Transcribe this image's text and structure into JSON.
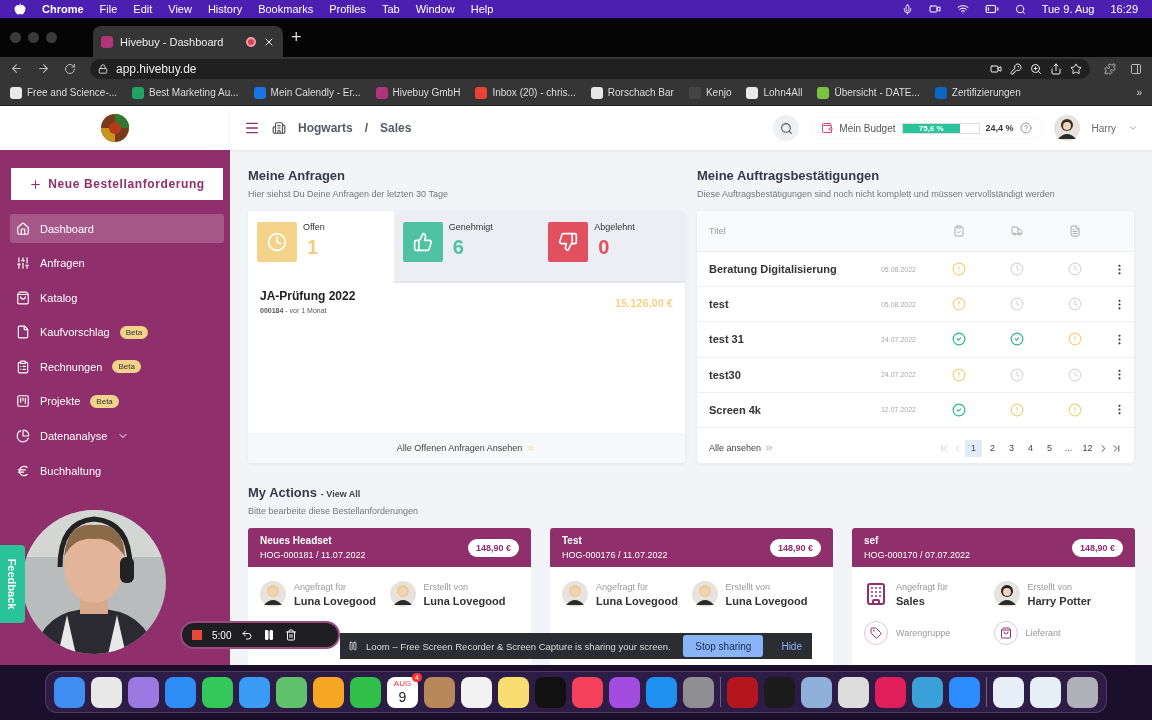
{
  "menubar": {
    "app": "Chrome",
    "menus": [
      "File",
      "Edit",
      "View",
      "History",
      "Bookmarks",
      "Profiles",
      "Tab",
      "Window",
      "Help"
    ],
    "date": "Tue 9. Aug",
    "time": "16:29"
  },
  "browser": {
    "tab": {
      "title": "Hivebuy - Dashboard",
      "selected": true
    },
    "new_tab": "+",
    "url": "app.hivebuy.de",
    "bookmarks": [
      {
        "label": "Free and Science-...",
        "color": "#e8e8e8"
      },
      {
        "label": "Best Marketing Au...",
        "color": "#1fa463"
      },
      {
        "label": "Mein Calendly - Er...",
        "color": "#1a73e8"
      },
      {
        "label": "Hivebuy GmbH",
        "color": "#b0347a"
      },
      {
        "label": "Inbox (20) - chris...",
        "color": "#ea4335"
      },
      {
        "label": "Rorschach Bar",
        "color": "#e8e8e8"
      },
      {
        "label": "Kenjo",
        "color": "#444444"
      },
      {
        "label": "Lohn4All",
        "color": "#e8e8e8"
      },
      {
        "label": "Übersicht - DATE...",
        "color": "#7cc242"
      },
      {
        "label": "Zertifizierungen",
        "color": "#0a66c2"
      }
    ],
    "more": "»"
  },
  "header": {
    "breadcrumb": [
      "Hogwarts",
      "Sales"
    ],
    "separator": "/",
    "budget": {
      "label": "Mein Budget",
      "level": 0.756,
      "used": "75,6 %",
      "rest": "24,4 %"
    },
    "user": "Harry"
  },
  "sidebar": {
    "new_button": "Neue Bestellanforderung",
    "items": [
      {
        "label": "Dashboard",
        "selected": true
      },
      {
        "label": "Anfragen",
        "selected": false
      },
      {
        "label": "Katalog",
        "selected": false
      },
      {
        "label": "Kaufvorschlag",
        "badge": "Beta",
        "selected": false
      },
      {
        "label": "Rechnungen",
        "badge": "Beta",
        "selected": false
      },
      {
        "label": "Projekte",
        "badge": "Beta",
        "selected": false
      },
      {
        "label": "Datenanalyse",
        "expandable": true,
        "selected": false
      },
      {
        "label": "Buchhaltung",
        "selected": false
      }
    ]
  },
  "requests": {
    "title": "Meine Anfragen",
    "subtitle": "Hier siehst Du Deine Anfragen der letzten 30 Tage",
    "stats": [
      {
        "kind": "open",
        "label": "Offen",
        "value": "1",
        "selected": true
      },
      {
        "kind": "approved",
        "label": "Genehmigt",
        "value": "6",
        "selected": false
      },
      {
        "kind": "rejected",
        "label": "Abgelehnt",
        "value": "0",
        "selected": false
      }
    ],
    "items": [
      {
        "title": "JA-Prüfung 2022",
        "meta": "**000184** - vor 1 Monat",
        "amount": "15.126,00 €"
      }
    ],
    "footer": "Alle Offenen Anfragen Ansehen"
  },
  "confirmations": {
    "title": "Meine Auftragsbestätigungen",
    "subtitle": "Diese Auftragsbestätigungen sind noch nicht komplett und müssen vervollständigt werden",
    "header": "Titel",
    "rows": [
      {
        "title": "Beratung Digitalisierung",
        "date": "05.08.2022",
        "statuses": [
          {
            "kind": "warning"
          },
          {
            "kind": "pending"
          },
          {
            "kind": "pending"
          }
        ]
      },
      {
        "title": "test",
        "date": "05.08.2022",
        "statuses": [
          {
            "kind": "warning"
          },
          {
            "kind": "pending"
          },
          {
            "kind": "pending"
          }
        ]
      },
      {
        "title": "test 31",
        "date": "24.07.2022",
        "statuses": [
          {
            "kind": "done"
          },
          {
            "kind": "done"
          },
          {
            "kind": "warning"
          }
        ]
      },
      {
        "title": "test30",
        "date": "24.07.2022",
        "statuses": [
          {
            "kind": "warning"
          },
          {
            "kind": "pending"
          },
          {
            "kind": "pending"
          }
        ]
      },
      {
        "title": "Screen 4k",
        "date": "12.07.2022",
        "statuses": [
          {
            "kind": "done"
          },
          {
            "kind": "warning"
          },
          {
            "kind": "warning"
          }
        ]
      }
    ],
    "footer": "Alle ansehen",
    "pages": [
      {
        "label": "1",
        "selected": true
      },
      {
        "label": "2",
        "selected": false
      },
      {
        "label": "3",
        "selected": false
      },
      {
        "label": "4",
        "selected": false
      },
      {
        "label": "5",
        "selected": false
      },
      {
        "label": "...",
        "selected": false
      },
      {
        "label": "12",
        "selected": false
      }
    ]
  },
  "actions": {
    "title": "My Actions",
    "link": "- View All",
    "subtitle": "Bitte bearbeite diese Bestellanforderungen",
    "cards": [
      {
        "title": "Neues Headset",
        "ref": "HOG-000181 / 11.07.2022",
        "price": "148,90 €",
        "requested": {
          "kind": "person",
          "label": "Angefragt für",
          "value": "Luna Lovegood"
        },
        "created_label": "Erstellt von",
        "created": "Luna Lovegood"
      },
      {
        "title": "Test",
        "ref": "HOG-000176 / 11.07.2022",
        "price": "148,90 €",
        "requested": {
          "kind": "person",
          "label": "Angefragt für",
          "value": "Luna Lovegood"
        },
        "created_label": "Erstellt von",
        "created": "Luna Lovegood"
      },
      {
        "title": "sef",
        "ref": "HOG-000170 / 07.07.2022",
        "price": "148,90 €",
        "requested": {
          "kind": "department",
          "label": "Angefragt für",
          "value": "Sales"
        },
        "created_label": "Erstellt von",
        "created": "Harry Potter",
        "extra": [
          "Warengruppe",
          "Lieferant"
        ]
      }
    ]
  },
  "feedback": "Feedback",
  "loom": {
    "timer": "5:00",
    "notice": "Loom – Free Screen Recorder & Screen Capture is sharing your screen.",
    "stop": "Stop sharing",
    "hide": "Hide"
  },
  "dock": {
    "items": [
      {
        "kind": "app",
        "color": "#3d8ef0"
      },
      {
        "kind": "app",
        "color": "#e8e8e8"
      },
      {
        "kind": "app",
        "color": "#9a7ae0"
      },
      {
        "kind": "app",
        "color": "#2f8ef5"
      },
      {
        "kind": "app",
        "color": "#34c759"
      },
      {
        "kind": "app",
        "color": "#3a9bf5"
      },
      {
        "kind": "app",
        "color": "#5fc26a"
      },
      {
        "kind": "app",
        "color": "#f5a623"
      },
      {
        "kind": "app",
        "color": "#30c04a"
      },
      {
        "kind": "calendar",
        "month": "AUG",
        "day": "9",
        "badge": "4"
      },
      {
        "kind": "app",
        "color": "#b8885a"
      },
      {
        "kind": "app",
        "color": "#f2f2f2"
      },
      {
        "kind": "app",
        "color": "#f7dc6f"
      },
      {
        "kind": "app",
        "color": "#111111"
      },
      {
        "kind": "app",
        "color": "#f5405a"
      },
      {
        "kind": "app",
        "color": "#a34de0"
      },
      {
        "kind": "app",
        "color": "#1f8ff0"
      },
      {
        "kind": "app",
        "color": "#8e8e93"
      },
      {
        "kind": "divider"
      },
      {
        "kind": "app",
        "color": "#b3161c"
      },
      {
        "kind": "app",
        "color": "#1c1c1c"
      },
      {
        "kind": "app",
        "color": "#8fb0d8"
      },
      {
        "kind": "app",
        "color": "#dcdcdc"
      },
      {
        "kind": "app",
        "color": "#e01e5a"
      },
      {
        "kind": "app",
        "color": "#3aa0d8"
      },
      {
        "kind": "app",
        "color": "#2d8cff"
      },
      {
        "kind": "divider"
      },
      {
        "kind": "app",
        "color": "#e6eef8"
      },
      {
        "kind": "app",
        "color": "#e6eef8"
      },
      {
        "kind": "app",
        "color": "#b0b0b8"
      }
    ]
  }
}
